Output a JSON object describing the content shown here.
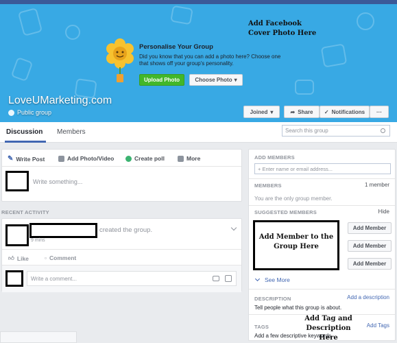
{
  "cover": {
    "note": "Add Facebook Cover Photo Here",
    "promo_title": "Personalise Your Group",
    "promo_text": "Did you know that you can add a photo here? Choose one that shows off your group's personality.",
    "upload_label": "Upload Photo",
    "choose_label": "Choose Photo",
    "group_name": "LoveUMarketing.com",
    "group_type": "Public group",
    "joined_label": "Joined",
    "share_label": "Share",
    "notifications_label": "Notifications",
    "more_label": "···"
  },
  "tabs": {
    "discussion": "Discussion",
    "members": "Members",
    "search_placeholder": "Search this group"
  },
  "composer": {
    "write_post": "Write Post",
    "add_photo": "Add Photo/Video",
    "create_poll": "Create poll",
    "more": "More",
    "placeholder": "Write something..."
  },
  "activity": {
    "label": "RECENT ACTIVITY",
    "post_text": "created the group.",
    "time": "9 mins",
    "like": "Like",
    "comment": "Comment",
    "comment_placeholder": "Write a comment..."
  },
  "sidebar": {
    "add_members_heading": "ADD MEMBERS",
    "add_input_placeholder": "+ Enter name or email address...",
    "members_heading": "MEMBERS",
    "member_count": "1 member",
    "only_member_text": "You are the only group member.",
    "suggested_heading": "SUGGESTED MEMBERS",
    "hide_label": "Hide",
    "add_member_label": "Add Member",
    "member_note": "Add Member to the Group Here",
    "see_more": "See More",
    "description_heading": "DESCRIPTION",
    "add_description": "Add a description",
    "description_text": "Tell people what this group is about.",
    "tags_heading": "TAGS",
    "add_tags": "Add Tags",
    "tags_text": "Add a few descriptive keywords.",
    "tag_note": "Add Tag and Description Here"
  },
  "colors": {
    "brand_blue": "#3b5998",
    "cover_blue": "#38a9e4",
    "upload_green": "#42b72a",
    "link_blue": "#4267b2"
  }
}
